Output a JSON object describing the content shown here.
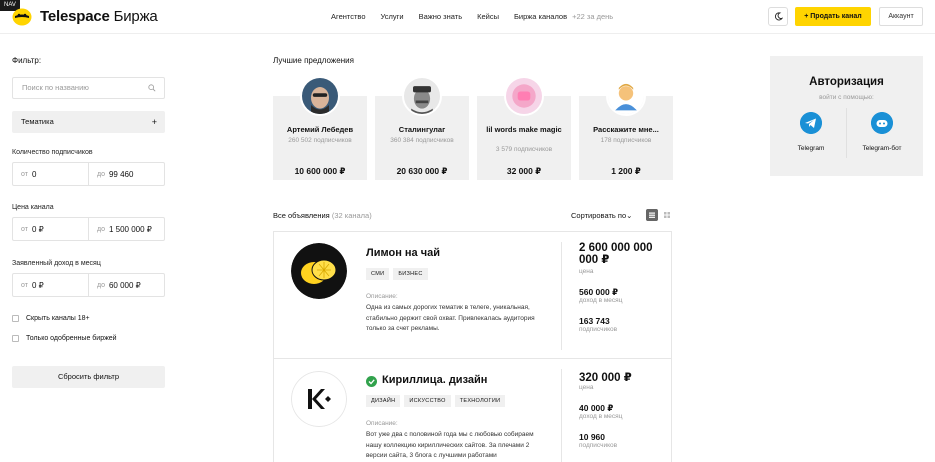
{
  "header": {
    "nav_tag": "NAV",
    "logo_main": "Telespace",
    "logo_sub": "Биржа",
    "nav": [
      "Агентство",
      "Услуги",
      "Важно знать",
      "Кейсы",
      "Биржа каналов"
    ],
    "nav_count": "+22 за день",
    "sell_label": "+ Продать канал",
    "account_label": "Аккаунт"
  },
  "filter": {
    "title": "Фильтр:",
    "search_placeholder": "Поиск по названию",
    "topic_label": "Тематика",
    "topic_plus": "+",
    "subs_label": "Количество подписчиков",
    "subs_from_pre": "от",
    "subs_from": "0",
    "subs_to_pre": "до",
    "subs_to": "99 460",
    "price_label": "Цена канала",
    "price_from_pre": "от",
    "price_from": "0 ₽",
    "price_to_pre": "до",
    "price_to": "1 500 000 ₽",
    "income_label": "Заявленный доход в месяц",
    "income_from_pre": "от",
    "income_from": "0 ₽",
    "income_to_pre": "до",
    "income_to": "60 000 ₽",
    "hide18": "Скрыть каналы 18+",
    "approved_only": "Только одобренные биржей",
    "reset_label": "Сбросить фильтр"
  },
  "best": {
    "title": "Лучшие предложения",
    "offers": [
      {
        "name": "Артемий Лебедев",
        "subs": "260 502 подписчиков",
        "price": "10 600 000 ₽"
      },
      {
        "name": "Сталингулаг",
        "subs": "360 384 подписчиков",
        "price": "20 630 000 ₽"
      },
      {
        "name": "lil words make magic",
        "subs": "3 579 подписчиков",
        "price": "32 000 ₽"
      },
      {
        "name": "Расскажите мне...",
        "subs": "178 подписчиков",
        "price": "1 200 ₽"
      }
    ]
  },
  "auth": {
    "title": "Авторизация",
    "subtitle": "войти с помощью:",
    "telegram": "Telegram",
    "telegram_bot": "Telegram-бот"
  },
  "list": {
    "title": "Все объявления",
    "count": "(32 канала)",
    "sort_label": "Сортировать по",
    "sort_chevron": "⌄"
  },
  "cards": [
    {
      "name": "Лимон на чай",
      "tags": [
        "СМИ",
        "БИЗНЕС"
      ],
      "desc_label": "Описание:",
      "desc": "Одна из самых дорогих тематик в телеге, уникальная, стабильно держит свой охват. Привлекалась аудитория только за счет рекламы.",
      "price": "2 600 000 000 000 ₽",
      "price_label": "цена",
      "income": "560 000 ₽",
      "income_label": "доход в месяц",
      "subs": "163 743",
      "subs_label": "подписчиков"
    },
    {
      "name": "Кириллица. дизайн",
      "tags": [
        "ДИЗАЙН",
        "ИСКУССТВО",
        "ТЕХНОЛОГИИ"
      ],
      "desc_label": "Описание:",
      "desc": "Вот уже два с половиной года мы с любовью собираем нашу коллекцию кириллических сайтов. За плечами 2 версии сайта, 3 блога с лучшими работами",
      "price": "320 000 ₽",
      "price_label": "цена",
      "income": "40 000 ₽",
      "income_label": "доход в месяц",
      "subs": "10 960",
      "subs_label": "подписчиков"
    }
  ]
}
